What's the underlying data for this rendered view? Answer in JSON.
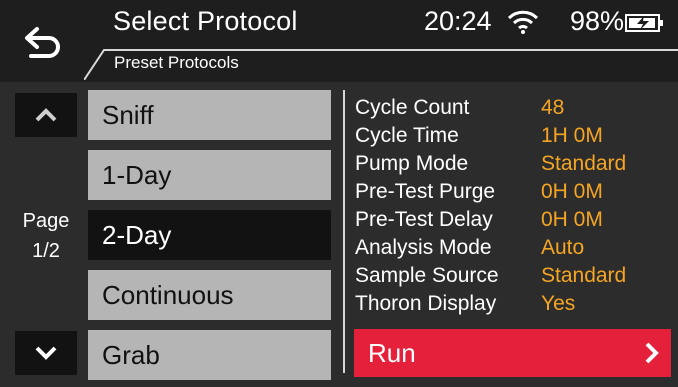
{
  "header": {
    "title": "Select Protocol",
    "subtitle": "Preset Protocols",
    "clock": "20:24",
    "battery_percent": "98%",
    "wifi_icon": "wifi-icon",
    "battery_icon": "battery-charging-icon",
    "back_icon": "back-arrow-icon"
  },
  "nav": {
    "page_label": "Page",
    "page_value": "1/2",
    "up_icon": "chevron-up-icon",
    "down_icon": "chevron-down-icon"
  },
  "protocols": [
    {
      "label": "Sniff",
      "selected": false
    },
    {
      "label": "1-Day",
      "selected": false
    },
    {
      "label": "2-Day",
      "selected": true
    },
    {
      "label": "Continuous",
      "selected": false
    },
    {
      "label": "Grab",
      "selected": false
    }
  ],
  "details": [
    {
      "key": "Cycle Count",
      "value": "48"
    },
    {
      "key": "Cycle Time",
      "value": "1H 0M"
    },
    {
      "key": "Pump Mode",
      "value": "Standard"
    },
    {
      "key": "Pre-Test Purge",
      "value": "0H 0M"
    },
    {
      "key": "Pre-Test Delay",
      "value": "0H 0M"
    },
    {
      "key": "Analysis Mode",
      "value": "Auto"
    },
    {
      "key": "Sample Source",
      "value": "Standard"
    },
    {
      "key": "Thoron Display",
      "value": "Yes"
    }
  ],
  "run": {
    "label": "Run",
    "icon": "chevron-right-icon"
  },
  "colors": {
    "accent_value": "#f5a524",
    "run_button": "#e4203a",
    "button_gray": "#b5b5b5",
    "selected_button": "#121212"
  }
}
